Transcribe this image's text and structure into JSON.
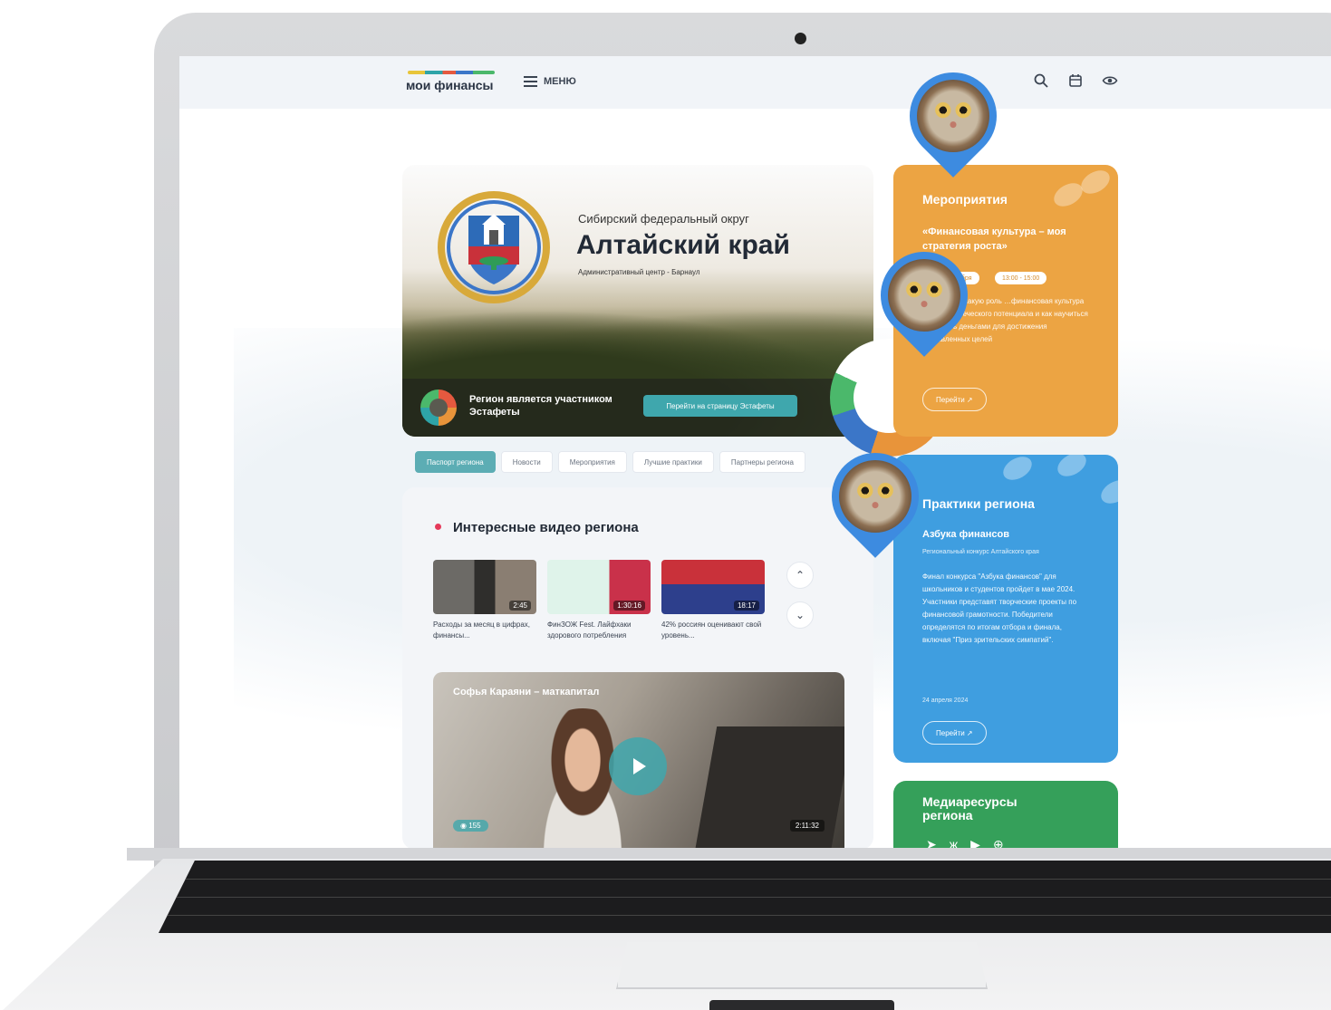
{
  "header": {
    "logo": "мои финансы",
    "menu_label": "МЕНЮ"
  },
  "hero": {
    "district": "Сибирский федеральный округ",
    "region": "Алтайский край",
    "caption": "Административный центр - Барнаул",
    "relay_text": "Регион является участником Эстафеты",
    "relay_button": "Перейти на страницу Эстафеты"
  },
  "tabs": [
    "Паспорт региона",
    "Новости",
    "Мероприятия",
    "Лучшие практики",
    "Партнеры региона"
  ],
  "videos": {
    "title": "Интересные видео региона",
    "items": [
      {
        "caption": "Расходы за месяц в цифрах, финансы...",
        "duration": "2:45"
      },
      {
        "caption": "ФинЗОЖ Fest. Лайфхаки здорового потребления",
        "duration": "1:30:16"
      },
      {
        "caption": "42% россиян оценивают свой уровень...",
        "duration": "18:17"
      }
    ],
    "featured": {
      "title": "Софья Караяни – маткапитал",
      "views": "155",
      "duration": "2:11:32"
    }
  },
  "events": {
    "heading": "Мероприятия",
    "title": "«Финансовая культура – моя стратегия роста»",
    "date": "…абря",
    "time": "13:00 - 15:00",
    "body": "…и обсудят какую роль …финансовая культура …тии человеческого потенциала и как научиться управлять деньгами для достижения поставленных целей",
    "button": "Перейти ↗"
  },
  "practices": {
    "heading": "Практики региона",
    "title": "Азбука финансов",
    "subtitle": "Региональный конкурс Алтайского края",
    "body": "Финал конкурса \"Азбука финансов\" для школьников и студентов пройдет в мае 2024. Участники представят творческие проекты по финансовой грамотности. Победители определятся по итогам отбора и финала, включая \"Приз зрительских симпатий\".",
    "date": "24 апреля 2024",
    "button": "Перейти ↗"
  },
  "media": {
    "heading": "Медиаресурсы региона"
  },
  "colors": {
    "accent": "#5cadb4",
    "events": "#eca443",
    "practices": "#3f9ee0",
    "media": "#35a05a"
  }
}
